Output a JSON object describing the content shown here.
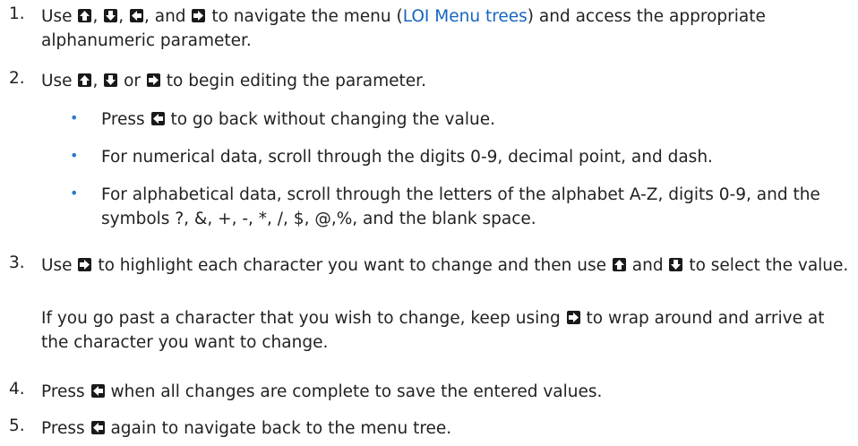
{
  "steps": [
    {
      "number": "1.",
      "parts": [
        {
          "t": "text",
          "v": "Use "
        },
        {
          "t": "key",
          "k": "up"
        },
        {
          "t": "text",
          "v": ", "
        },
        {
          "t": "key",
          "k": "down"
        },
        {
          "t": "text",
          "v": ", "
        },
        {
          "t": "key",
          "k": "left"
        },
        {
          "t": "text",
          "v": ", and "
        },
        {
          "t": "key",
          "k": "right"
        },
        {
          "t": "text",
          "v": " to navigate the menu ("
        },
        {
          "t": "link",
          "v": "LOI Menu trees"
        },
        {
          "t": "text",
          "v": ") and access the appropriate alphanumeric parameter."
        }
      ]
    },
    {
      "number": "2.",
      "parts": [
        {
          "t": "text",
          "v": "Use "
        },
        {
          "t": "key",
          "k": "up"
        },
        {
          "t": "text",
          "v": ", "
        },
        {
          "t": "key",
          "k": "down"
        },
        {
          "t": "text",
          "v": " or "
        },
        {
          "t": "key",
          "k": "right"
        },
        {
          "t": "text",
          "v": " to begin editing the parameter."
        }
      ]
    },
    {
      "number": "3.",
      "parts": [
        {
          "t": "text",
          "v": "Use "
        },
        {
          "t": "key",
          "k": "right"
        },
        {
          "t": "text",
          "v": " to highlight each character you want to change and then use "
        },
        {
          "t": "key",
          "k": "up"
        },
        {
          "t": "text",
          "v": " and "
        },
        {
          "t": "key",
          "k": "down"
        },
        {
          "t": "text",
          "v": " to select the value."
        }
      ]
    },
    {
      "number": "4.",
      "parts": [
        {
          "t": "text",
          "v": "Press "
        },
        {
          "t": "key",
          "k": "left"
        },
        {
          "t": "text",
          "v": " when all changes are complete to save the entered values."
        }
      ]
    },
    {
      "number": "5.",
      "parts": [
        {
          "t": "text",
          "v": "Press "
        },
        {
          "t": "key",
          "k": "left"
        },
        {
          "t": "text",
          "v": " again to navigate back to the menu tree."
        }
      ]
    }
  ],
  "bullets": [
    {
      "parts": [
        {
          "t": "text",
          "v": "Press "
        },
        {
          "t": "key",
          "k": "left"
        },
        {
          "t": "text",
          "v": " to go back without changing the value."
        }
      ]
    },
    {
      "parts": [
        {
          "t": "text",
          "v": "For numerical data, scroll through the digits 0-9, decimal point, and dash."
        }
      ]
    },
    {
      "parts": [
        {
          "t": "text",
          "v": "For alphabetical data, scroll through the letters of the alphabet A-Z, digits 0-9, and the symbols ?, &, +, -, *, /, $, @,%, and the blank space."
        }
      ]
    }
  ],
  "note": {
    "parts": [
      {
        "t": "text",
        "v": "If you go past a character that you wish to change, keep using "
      },
      {
        "t": "key",
        "k": "right"
      },
      {
        "t": "text",
        "v": " to wrap around and arrive at the character you want to change."
      }
    ]
  },
  "bullet_symbol": "•"
}
